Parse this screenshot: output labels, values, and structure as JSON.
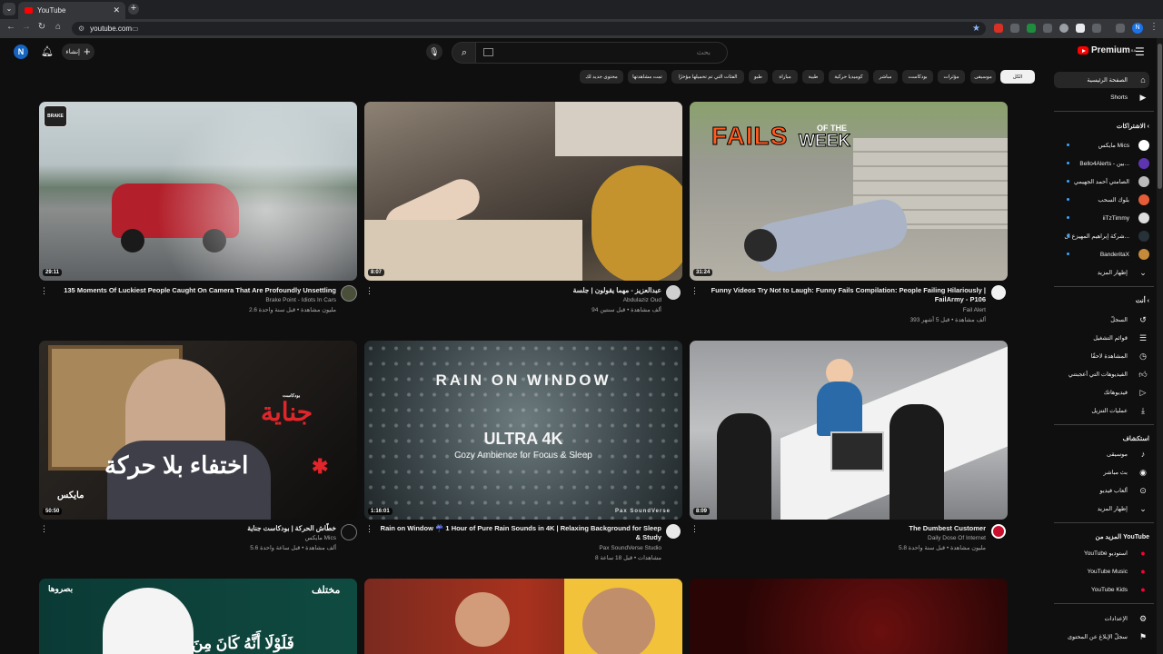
{
  "browser": {
    "tab_title": "YouTube",
    "tab_close": "✕",
    "new_tab": "+",
    "url": "youtube.com",
    "profile_initial": "N"
  },
  "masthead": {
    "avatar_initial": "N",
    "create_label": "إنشاء",
    "search_placeholder": "بحث",
    "logo_text": "Premium",
    "logo_sup": "SA"
  },
  "chips": [
    "الكل",
    "موسيقى",
    "مؤثرات",
    "بودكاست",
    "مباشر",
    "كوميديا حركية",
    "طيبة",
    "مباراة",
    "طبو",
    "الفئات التي تم تحميلها مؤخرًا",
    "تمت مشاهدتها",
    "محتوى جديد لك"
  ],
  "videos": [
    {
      "duration": "29:11",
      "title": "135 Moments Of Luckiest People Caught On Camera That Are Profoundly Unsettling",
      "channel": "Brake Point - Idiots In Cars",
      "meta": "2.6 مليون مشاهدة • قبل سنة واحدة",
      "thumb_badge": "BRAKE"
    },
    {
      "duration": "8:07",
      "title": "عبدالعزيز - مهما يقولون | جلسة",
      "channel": "Abdulaziz Oud",
      "meta": "94 ألف مشاهدة • قبل سنتين"
    },
    {
      "duration": "31:24",
      "title": "Funny Videos Try Not to Laugh: Funny Fails Compilation: People Failing Hilariously | FailArmy - P106",
      "channel": "Fail Alert",
      "meta": "393 ألف مشاهدة • قبل 5 أشهر",
      "thumb_text_1": "FAILS",
      "thumb_text_2": "OF THE",
      "thumb_text_3": "WEEK"
    },
    {
      "duration": "50:50",
      "title": "خطّاش الحركة | بودكاست جناية",
      "channel": "مايكس Mics",
      "meta": "5.6 ألف مشاهدة • قبل ساعة واحدة",
      "thumb_text_1": "جناية",
      "thumb_text_2": "اختفاء بلا حركة",
      "thumb_text_3": "مايكس",
      "thumb_text_4": "بودكاست"
    },
    {
      "duration": "1:16:01",
      "title": "Rain on Window ☔ 1 Hour of Pure Rain Sounds in 4K | Relaxing Background for Sleep & Study",
      "channel": "Pax SoundVerse Studio",
      "meta": "8 مشاهدات • قبل 18 ساعة",
      "thumb_text_1": "RAIN ON WINDOW",
      "thumb_text_2": "ULTRA 4K",
      "thumb_text_3": "Cozy Ambience for Focus & Sleep",
      "thumb_text_4": "Pax SoundVerse"
    },
    {
      "duration": "8:09",
      "title": "The Dumbest Customer",
      "channel": "Daily Dose Of Internet",
      "meta": "5.8 مليون مشاهدة • قبل سنة واحدة"
    },
    {
      "thumb_text_1": "بصروها",
      "thumb_text_2": "فَلَوْلَا أَنَّهُ كَانَ مِنَ"
    },
    {},
    {}
  ],
  "top_right_text": "مختلف",
  "sidebar": {
    "home": "الصفحة الرئيسية",
    "shorts": "Shorts",
    "subs_head": "الاشتراكات",
    "subs": [
      "مايكس Mics",
      "Bello4Alerts - بين...",
      "الصامتي أحمد الجهيمي",
      "بلوك السحب",
      "iiTzTimmy",
      "شركة إبراهيم المهيزع ال...",
      "BanderitaX"
    ],
    "subs_more": "إظهار المزيد",
    "you_head": "أنت",
    "you": [
      "السجلّ",
      "قوائم التشغيل",
      "المشاهدة لاحقًا",
      "الفيديوهات التي أعجبتني",
      "فيديوهاتك",
      "عمليات التنزيل"
    ],
    "explore_head": "استكشاف",
    "explore": [
      "موسيقى",
      "بث مباشر",
      "ألعاب فيديو",
      "إظهار المزيد"
    ],
    "more_head": "المزيد من YouTube",
    "more": [
      "YouTube استوديو",
      "YouTube Music",
      "YouTube Kids"
    ],
    "settings": "الإعدادات",
    "report": "سجلّ الإبلاغ عن المحتوى"
  },
  "colors": {
    "accent": "#ff0000",
    "link": "#3ea6ff",
    "bg": "#0f0f0f"
  }
}
